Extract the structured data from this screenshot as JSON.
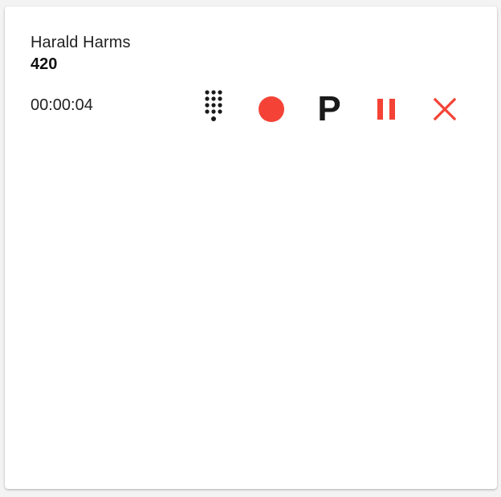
{
  "call": {
    "caller_name": "Harald Harms",
    "extension": "420",
    "duration": "00:00:04"
  },
  "controls": {
    "dialpad": {
      "icon": "dialpad-icon"
    },
    "record": {
      "icon": "record-icon"
    },
    "park": {
      "label": "P",
      "icon": "park-icon"
    },
    "hold": {
      "icon": "pause-icon"
    },
    "hangup": {
      "icon": "close-icon"
    }
  },
  "colors": {
    "accent_red": "#f44336",
    "icon_dark": "#1a1a1a"
  }
}
